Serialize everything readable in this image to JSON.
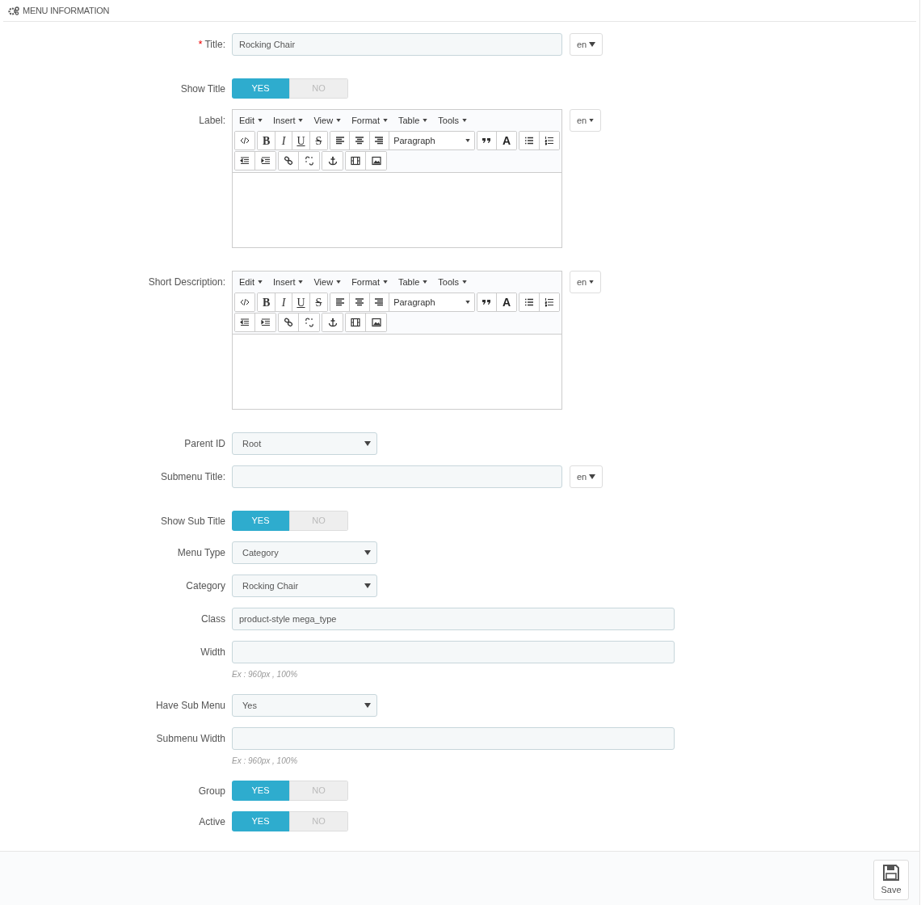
{
  "panel": {
    "title": "MENU INFORMATION"
  },
  "fields": [
    {
      "kind": "text",
      "label": "Title:",
      "required_mark": "*",
      "value": "Rocking Chair",
      "lang": "en"
    },
    {
      "kind": "toggle",
      "label": "Show Title",
      "options": [
        {
          "label": "YES",
          "selected": true
        },
        {
          "label": "NO",
          "selected": false
        }
      ]
    },
    {
      "kind": "editor",
      "label": "Label:",
      "menus": [
        "Edit",
        "Insert",
        "View",
        "Format",
        "Table",
        "Tools"
      ],
      "text_buttons": [
        "B",
        "I",
        "U",
        "S"
      ],
      "block_format": "Paragraph",
      "color_button": "A",
      "lang": "en"
    },
    {
      "kind": "editor",
      "label": "Short Description:",
      "menus": [
        "Edit",
        "Insert",
        "View",
        "Format",
        "Table",
        "Tools"
      ],
      "text_buttons": [
        "B",
        "I",
        "U",
        "S"
      ],
      "block_format": "Paragraph",
      "color_button": "A",
      "lang": "en"
    },
    {
      "kind": "select",
      "label": "Parent ID",
      "value": "Root"
    },
    {
      "kind": "text",
      "label": "Submenu Title:",
      "lang": "en"
    },
    {
      "kind": "toggle",
      "label": "Show Sub Title",
      "options": [
        {
          "label": "YES",
          "selected": true
        },
        {
          "label": "NO",
          "selected": false
        }
      ]
    },
    {
      "kind": "select",
      "label": "Menu Type",
      "value": "Category"
    },
    {
      "kind": "select",
      "label": "Category",
      "value": "Rocking Chair"
    },
    {
      "kind": "text",
      "label": "Class",
      "value": "product-style mega_type"
    },
    {
      "kind": "text",
      "label": "Width",
      "hint": "Ex : 960px , 100%"
    },
    {
      "kind": "select",
      "label": "Have Sub Menu",
      "value": "Yes"
    },
    {
      "kind": "text",
      "label": "Submenu Width",
      "hint": "Ex : 960px , 100%"
    },
    {
      "kind": "toggle",
      "label": "Group",
      "options": [
        {
          "label": "YES",
          "selected": true
        },
        {
          "label": "NO",
          "selected": false
        }
      ]
    },
    {
      "kind": "toggle",
      "label": "Active",
      "options": [
        {
          "label": "YES",
          "selected": true
        },
        {
          "label": "NO",
          "selected": false
        }
      ]
    }
  ],
  "footer": {
    "save_button": "Save"
  }
}
